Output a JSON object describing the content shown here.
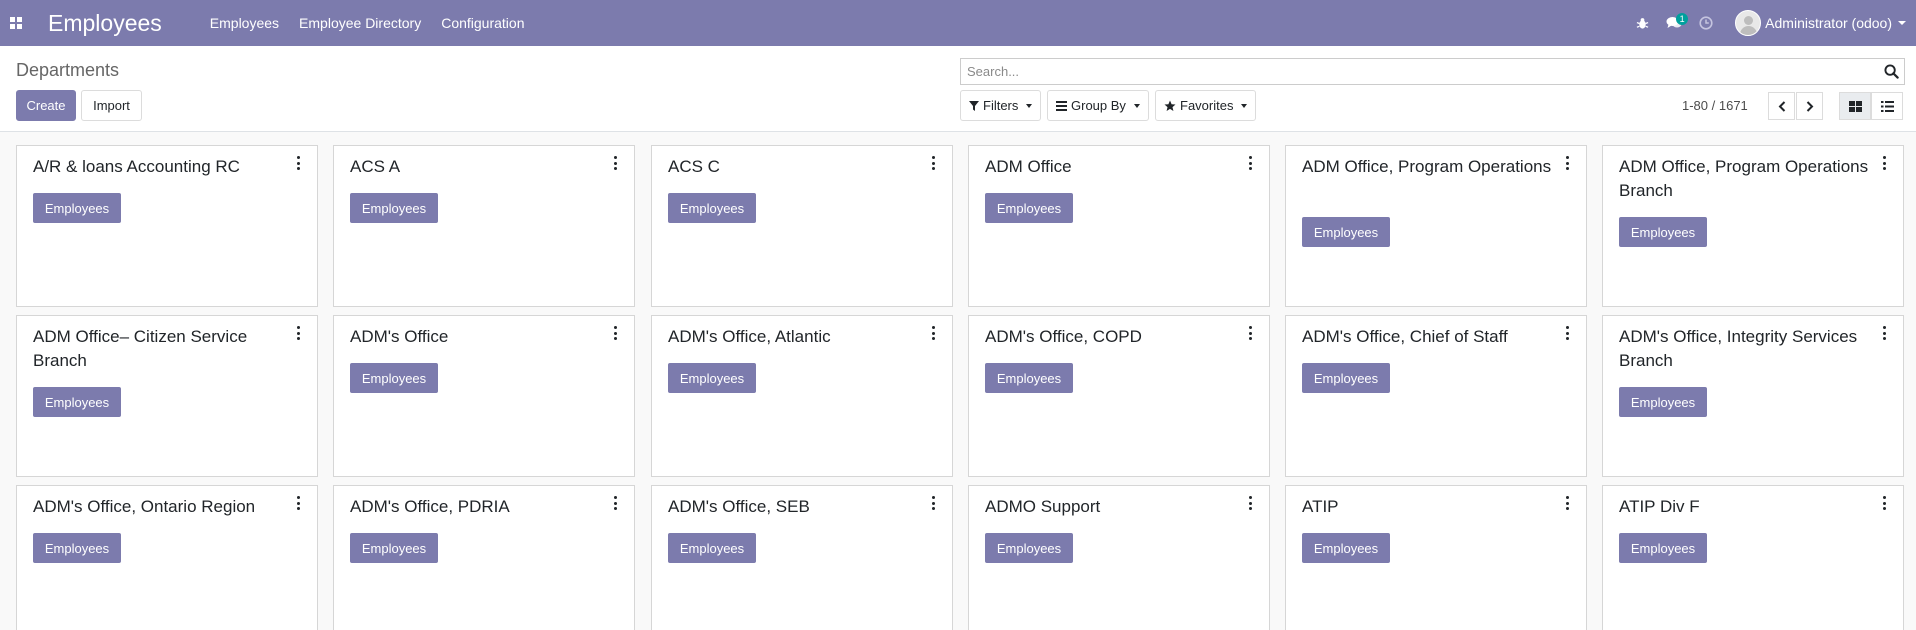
{
  "navbar": {
    "app_title": "Employees",
    "menu": [
      "Employees",
      "Employee Directory",
      "Configuration"
    ],
    "messages_count": "1",
    "user_name": "Administrator (odoo)",
    "brand_color": "#7c7bad"
  },
  "control": {
    "breadcrumb": "Departments",
    "create_label": "Create",
    "import_label": "Import",
    "search_placeholder": "Search...",
    "filters_label": "Filters",
    "groupby_label": "Group By",
    "favorites_label": "Favorites",
    "pager": "1-80 / 1671",
    "active_view": "kanban"
  },
  "cards": [
    {
      "name": "A/R & loans Accounting RC",
      "button": "Employees"
    },
    {
      "name": "ACS A",
      "button": "Employees"
    },
    {
      "name": "ACS C",
      "button": "Employees"
    },
    {
      "name": "ADM Office",
      "button": "Employees"
    },
    {
      "name": "ADM Office, Program Operations",
      "button": "Employees"
    },
    {
      "name": "ADM Office, Program Operations Branch",
      "button": "Employees"
    },
    {
      "name": "ADM Office– Citizen Service Branch",
      "button": "Employees"
    },
    {
      "name": "ADM's Office",
      "button": "Employees"
    },
    {
      "name": "ADM's Office, Atlantic",
      "button": "Employees"
    },
    {
      "name": "ADM's Office, COPD",
      "button": "Employees"
    },
    {
      "name": "ADM's Office, Chief of Staff",
      "button": "Employees"
    },
    {
      "name": "ADM's Office, Integrity Services Branch",
      "button": "Employees"
    },
    {
      "name": "ADM's Office, Ontario Region",
      "button": "Employees"
    },
    {
      "name": "ADM's Office, PDRIA",
      "button": "Employees"
    },
    {
      "name": "ADM's Office, SEB",
      "button": "Employees"
    },
    {
      "name": "ADMO Support",
      "button": "Employees"
    },
    {
      "name": "ATIP",
      "button": "Employees"
    },
    {
      "name": "ATIP Div F",
      "button": "Employees"
    }
  ]
}
